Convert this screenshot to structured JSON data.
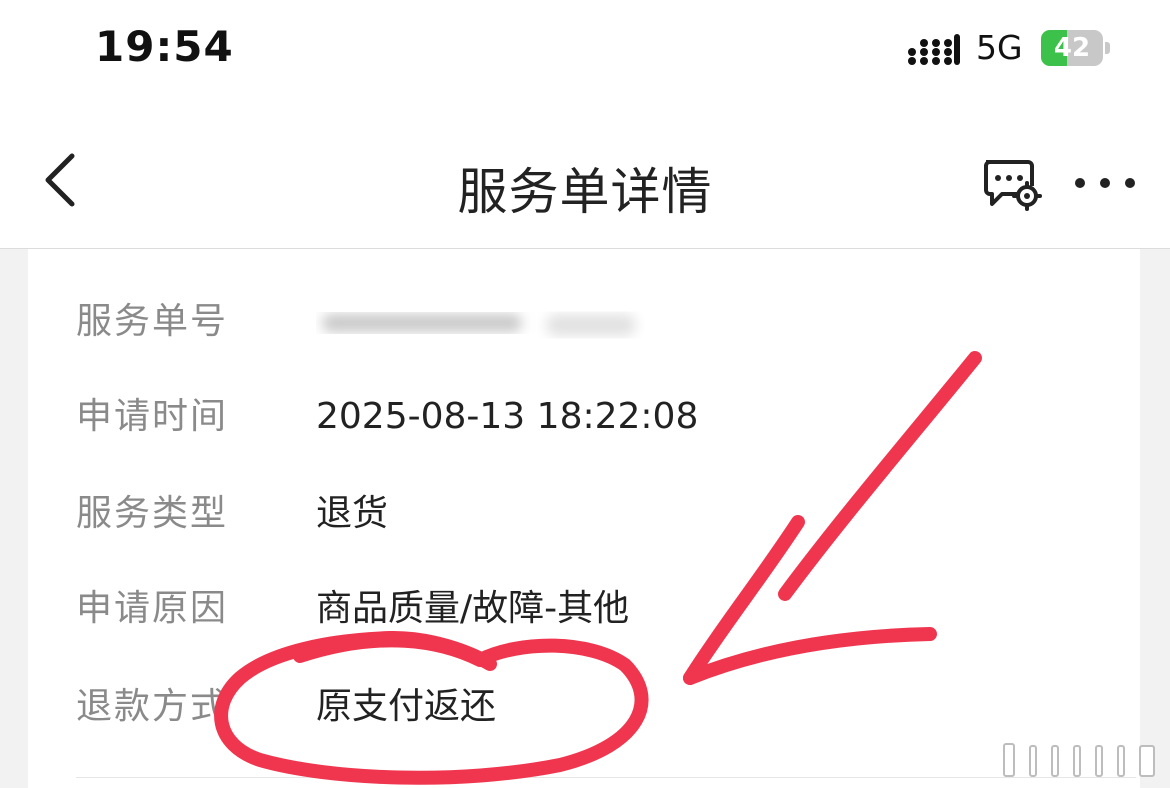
{
  "status_bar": {
    "time": "19:54",
    "network": "5G",
    "battery": "42",
    "battery_level": 0.42,
    "signal_icon": "signal-bars-icon",
    "battery_icon": "battery-charging-icon"
  },
  "nav": {
    "title": "服务单详情",
    "back_icon": "chevron-left-icon",
    "chat_icon": "chat-settings-icon",
    "more_icon": "more-dots-icon"
  },
  "details": {
    "order_no_label": "服务单号",
    "apply_time_label": "申请时间",
    "apply_time_value": "2025-08-13 18:22:08",
    "service_type_label": "服务类型",
    "service_type_value": "退货",
    "reason_label": "申请原因",
    "reason_value": "商品质量/故障-其他",
    "refund_method_label": "退款方式",
    "refund_method_value": "原支付返还"
  },
  "colors": {
    "annotation": "#f0364f",
    "battery_green": "#3cc24a",
    "label_gray": "#8a8a8a"
  }
}
